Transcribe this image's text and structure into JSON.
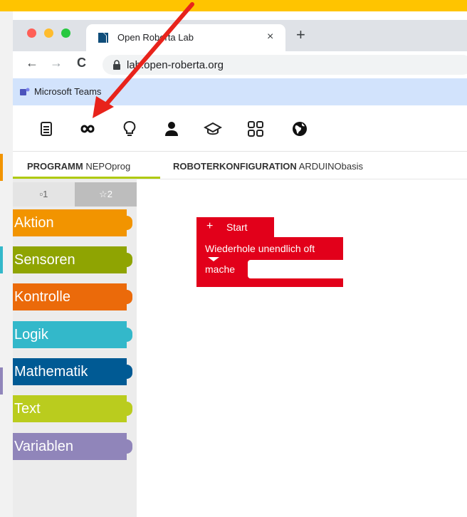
{
  "browser": {
    "tab_title": "Open Roberta Lab",
    "tab_close": "×",
    "new_tab": "+",
    "nav": {
      "back": "←",
      "forward": "→",
      "reload": "C"
    },
    "url": "lab.open-roberta.org",
    "bookmark": "Microsoft Teams",
    "traffic_colors": [
      "#ff5f57",
      "#febc2e",
      "#28c840"
    ]
  },
  "header": {
    "icons": [
      "program-list-icon",
      "infinity-icon",
      "lightbulb-icon",
      "user-icon",
      "graduation-cap-icon",
      "grid-icon",
      "globe-icon"
    ]
  },
  "program_tabs": [
    {
      "bold": "PROGRAMM",
      "normal": "NEPOprog"
    },
    {
      "bold": "ROBOTERKONFIGURATION",
      "normal": "ARDUINObasis"
    }
  ],
  "sidebar": {
    "level_tabs": [
      "▫1",
      "☆2"
    ],
    "categories": [
      {
        "label": "Aktion",
        "color": "#f29400"
      },
      {
        "label": "Sensoren",
        "color": "#8fa402"
      },
      {
        "label": "Kontrolle",
        "color": "#eb6a0a"
      },
      {
        "label": "Logik",
        "color": "#33b8ca"
      },
      {
        "label": "Mathematik",
        "color": "#005a94"
      },
      {
        "label": "Text",
        "color": "#bacc1e"
      },
      {
        "label": "Variablen",
        "color": "#9085ba"
      }
    ]
  },
  "blocks": {
    "start_plus": "+",
    "start_label": "Start",
    "loop_label": "Wiederhole unendlich oft",
    "do_label": "mache",
    "block_color": "#e2001a"
  },
  "colors": {
    "highlight": "#ffc400",
    "accent": "#afca0b",
    "arrow": "#e8231b"
  }
}
